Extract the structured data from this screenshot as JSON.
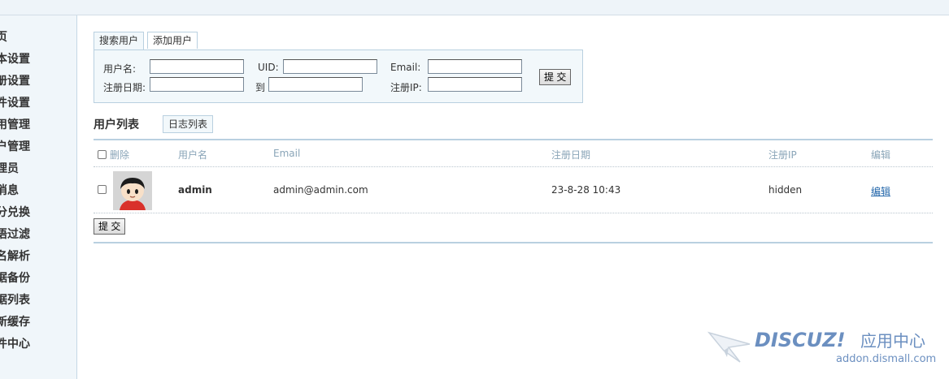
{
  "sidebar": {
    "items": [
      "首页",
      "基本设置",
      "注册设置",
      "邮件设置",
      "应用管理",
      "用户管理",
      "管理员",
      "短消息",
      "积分兑换",
      "词语过滤",
      "域名解析",
      "数据备份",
      "数据列表",
      "更新缓存",
      "插件中心"
    ]
  },
  "search": {
    "tabs": [
      "搜索用户",
      "添加用户"
    ],
    "labels": {
      "username": "用户名:",
      "uid": "UID:",
      "email": "Email:",
      "regdate": "注册日期:",
      "to": "到",
      "regip": "注册IP:"
    },
    "submit": "提 交"
  },
  "list": {
    "title": "用户列表",
    "log_tab": "日志列表",
    "headers": {
      "delete": "删除",
      "username": "用户名",
      "email": "Email",
      "regdate": "注册日期",
      "regip": "注册IP",
      "edit": "编辑"
    },
    "rows": [
      {
        "username": "admin",
        "email": "admin@admin.com",
        "regdate": "23-8-28 10:43",
        "regip": "hidden",
        "edit": "编辑"
      }
    ],
    "submit": "提 交"
  },
  "watermark": {
    "brand": "DISCUZ!",
    "suffix": "应用中心",
    "url": "addon.dismall.com"
  },
  "colors": {
    "accent_border": "#b9d0e0",
    "header_text": "#8aa5b8",
    "link": "#2266aa",
    "watermark": "#6b8fc0"
  }
}
